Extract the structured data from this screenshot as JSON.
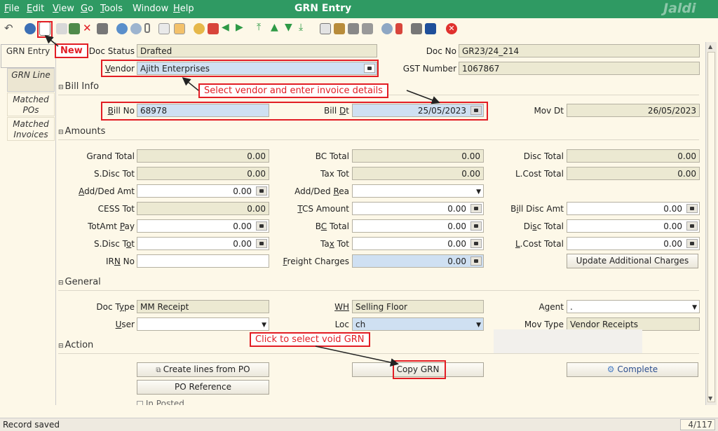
{
  "menu": {
    "items": [
      {
        "u": "F",
        "rest": "ile"
      },
      {
        "u": "E",
        "rest": "dit"
      },
      {
        "u": "V",
        "rest": "iew"
      },
      {
        "u": "G",
        "rest": "o"
      },
      {
        "u": "T",
        "rest": "ools"
      },
      {
        "u": "",
        "rest": "Window"
      },
      {
        "u": "H",
        "rest": "elp"
      }
    ],
    "window_title": "GRN Entry",
    "logo": "Jaldi"
  },
  "left_tabs": [
    "GRN Entry",
    "GRN Line",
    "Matched POs",
    "Matched Invoices"
  ],
  "header": {
    "doc_status_label": "Doc Status",
    "doc_status": "Drafted",
    "doc_no_label": "Doc No",
    "doc_no": "GR23/24_214",
    "vendor_label_u": "V",
    "vendor_label_rest": "endor",
    "vendor": "Ajith Enterprises",
    "gst_label": "GST Number",
    "gst": "1067867"
  },
  "bill_info": {
    "section": "Bill Info",
    "bill_no_u": "B",
    "bill_no_rest": "ill No",
    "bill_no": "68978",
    "bill_dt_pre": "Bill ",
    "bill_dt_u": "D",
    "bill_dt_rest": "t",
    "bill_dt": "25/05/2023",
    "mov_dt_label": "Mov Dt",
    "mov_dt": "26/05/2023"
  },
  "amounts": {
    "section": "Amounts",
    "grand_total_label": "Grand Total",
    "grand_total": "0.00",
    "bc_total_label": "BC Total",
    "bc_total": "0.00",
    "disc_total_label": "Disc Total",
    "disc_total": "0.00",
    "sdisc_tot_label": "S.Disc Tot",
    "sdisc_tot": "0.00",
    "tax_tot_label": "Tax Tot",
    "tax_tot": "0.00",
    "lcost_total_label": "L.Cost Total",
    "lcost_total": "0.00",
    "add_ded_amt_u": "A",
    "add_ded_amt_rest": "dd/Ded Amt",
    "add_ded_amt": "0.00",
    "add_ded_rea_pre": "Add/Ded ",
    "add_ded_rea_u": "R",
    "add_ded_rea_rest": "ea",
    "add_ded_rea": "",
    "cess_tot_label": "CESS Tot",
    "cess_tot": "0.00",
    "tcs_amount_u": "T",
    "tcs_amount_rest": "CS Amount",
    "tcs_amount": "0.00",
    "bill_disc_amt_pre": "B",
    "bill_disc_amt_u": "i",
    "bill_disc_amt_rest": "ll Disc Amt",
    "bill_disc_amt": "0.00",
    "totamt_pay_pre": "TotAmt ",
    "totamt_pay_u": "P",
    "totamt_pay_rest": "ay",
    "totamt_pay": "0.00",
    "bc_total2_pre": "B",
    "bc_total2_u": "C",
    "bc_total2_rest": " Total",
    "bc_total2": "0.00",
    "disc_total2_pre": "Di",
    "disc_total2_u": "s",
    "disc_total2_rest": "c Total",
    "disc_total2": "0.00",
    "sdisc_tot2_pre": "S.Disc T",
    "sdisc_tot2_u": "o",
    "sdisc_tot2_rest": "t",
    "sdisc_tot2": "0.00",
    "tax_tot2_pre": "Ta",
    "tax_tot2_u": "x",
    "tax_tot2_rest": " Tot",
    "tax_tot2": "0.00",
    "lcost_total2_u": "L",
    "lcost_total2_rest": ".Cost Total",
    "lcost_total2": "0.00",
    "irn_pre": "IR",
    "irn_u": "N",
    "irn_rest": " No",
    "irn_no": "",
    "freight_u": "F",
    "freight_rest": "reight Charges",
    "freight": "0.00",
    "update_charges": "Update Additional Charges"
  },
  "general": {
    "section": "General",
    "doc_type_pre": "Doc T",
    "doc_type_u": "y",
    "doc_type_rest": "pe",
    "doc_type": "MM Receipt",
    "wh_label": "WH",
    "wh": "Selling Floor",
    "agent_pre": "A",
    "agent_u": "g",
    "agent_rest": "ent",
    "agent": ".",
    "user_u": "U",
    "user_rest": "ser",
    "user": "",
    "loc_label": "Loc",
    "loc": "ch",
    "mov_type_label": "Mov Type",
    "mov_type": "Vendor Receipts"
  },
  "action": {
    "section": "Action",
    "create_lines": "Create lines from PO",
    "copy_grn": "Copy GRN",
    "complete": "Complete",
    "po_reference": "PO Reference",
    "in_posted": "In Posted"
  },
  "annotations": {
    "new": "New",
    "select_vendor": "Select vendor and enter invoice details",
    "void_grn": "Click to select void GRN"
  },
  "status": {
    "text": "Record saved",
    "page": "4/117"
  },
  "colors": {
    "menubar": "#2f9a63",
    "annotation": "#e21d24",
    "mandatory_field": "#cfe0f2"
  }
}
